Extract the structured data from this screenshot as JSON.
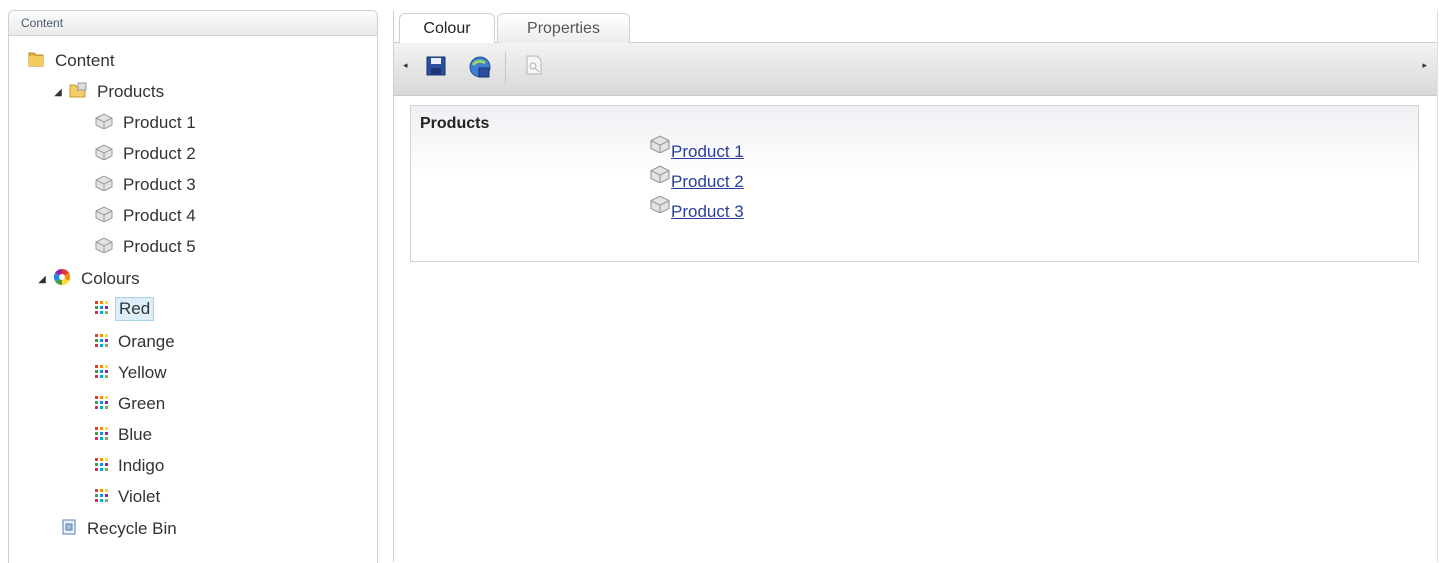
{
  "left_panel": {
    "title": "Content"
  },
  "tree": {
    "root": {
      "label": "Content"
    },
    "products": {
      "label": "Products",
      "items": [
        "Product 1",
        "Product 2",
        "Product 3",
        "Product 4",
        "Product 5"
      ]
    },
    "colours": {
      "label": "Colours",
      "items": [
        "Red",
        "Orange",
        "Yellow",
        "Green",
        "Blue",
        "Indigo",
        "Violet"
      ],
      "selected": "Red"
    },
    "recycle_bin": {
      "label": "Recycle Bin"
    }
  },
  "tabs": [
    {
      "label": "Colour",
      "active": true
    },
    {
      "label": "Properties",
      "active": false
    }
  ],
  "toolbar": {
    "buttons": [
      "save-icon",
      "save-publish-icon",
      "preview-icon"
    ]
  },
  "content": {
    "property_label": "Products",
    "links": [
      "Product 1",
      "Product 2",
      "Product 3"
    ]
  }
}
